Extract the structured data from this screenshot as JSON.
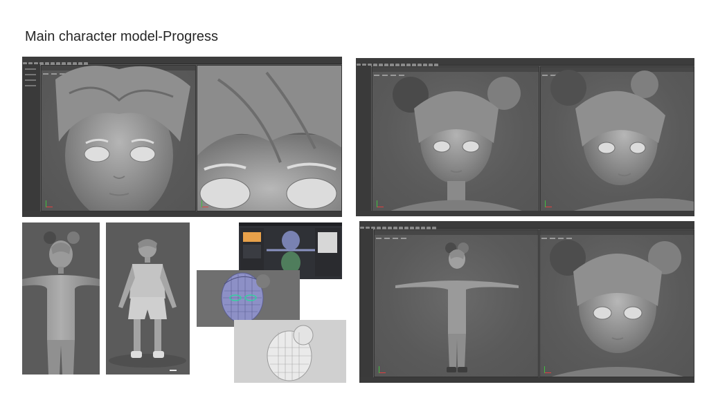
{
  "slide": {
    "title": "Main character model-Progress"
  },
  "panels": [
    {
      "name": "face-closeup-maya-viewports",
      "content": "Maya window with two viewports showing character face close-ups"
    },
    {
      "name": "head-renders-maya-viewports",
      "content": "Maya window with front and three-quarter head views"
    },
    {
      "name": "body-front-blockout",
      "content": "Front view of character body base mesh"
    },
    {
      "name": "body-clothed-blockout",
      "content": "Clothed character standing on grid"
    },
    {
      "name": "topology-screenshot",
      "content": "Modeling software with wireframe topology"
    },
    {
      "name": "head-wireframe",
      "content": "Head wireframe with colored edge loops"
    },
    {
      "name": "head-wireframe-white",
      "content": "White wireframe head render"
    },
    {
      "name": "full-body-maya-viewports",
      "content": "Maya window with full body T-pose and head close-up"
    }
  ],
  "colors": {
    "viewport": "#5b5b5b",
    "toolbar": "#3c3c3c",
    "model": "#9d9d9d"
  }
}
